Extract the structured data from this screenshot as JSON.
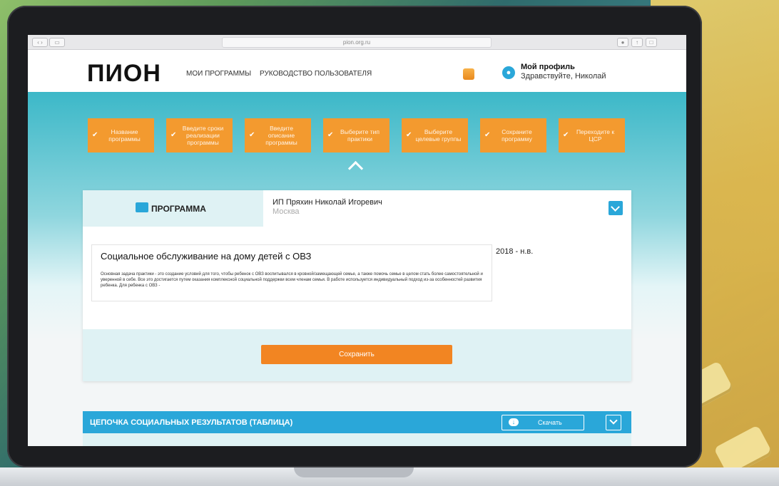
{
  "browser": {
    "url": "pion.org.ru",
    "back_icon": "chevron-left-icon",
    "forward_icon": "chevron-right-icon",
    "sidebar_icon": "sidebar-icon"
  },
  "header": {
    "logo": "ПИОН",
    "nav": [
      "МОИ ПРОГРАММЫ",
      "РУКОВОДСТВО ПОЛЬЗОВАТЕЛЯ"
    ],
    "profile_title": "Мой профиль",
    "profile_greeting": "Здравствуйте, Николай"
  },
  "steps": [
    "Название программы",
    "Введите сроки реализации программы",
    "Введите описание программы",
    "Выберите тип практики",
    "Выберите целевые группы",
    "Сохраните программу",
    "Переходите к ЦСР"
  ],
  "program": {
    "tab_label": "ПРОГРАММА",
    "org_name": "ИП Пряхин Николай Игоревич",
    "org_city": "Москва",
    "title": "Социальное обслуживание на дому детей с ОВЗ",
    "description": "Основная задача практики - это создание условий для того, чтобы ребенок с ОВЗ воспитывался в кровной/замещающей семье, а также помочь семье в целом стать более самостоятельной и уверенной в себе. Все это достигается путем оказания комплексной социальной поддержки всем членам семьи. В работе используется индивидуальный подход из-за особенностей развития ребенка. Для ребенка с ОВЗ -",
    "years": "2018 - н.в.",
    "save_label": "Сохранить"
  },
  "chain": {
    "title": "ЦЕПОЧКА СОЦИАЛЬНЫХ РЕЗУЛЬТАТОВ (ТАБЛИЦА)",
    "download_label": "Скачать"
  },
  "colors": {
    "accent": "#f39a2f",
    "primary": "#2aa7d9"
  }
}
